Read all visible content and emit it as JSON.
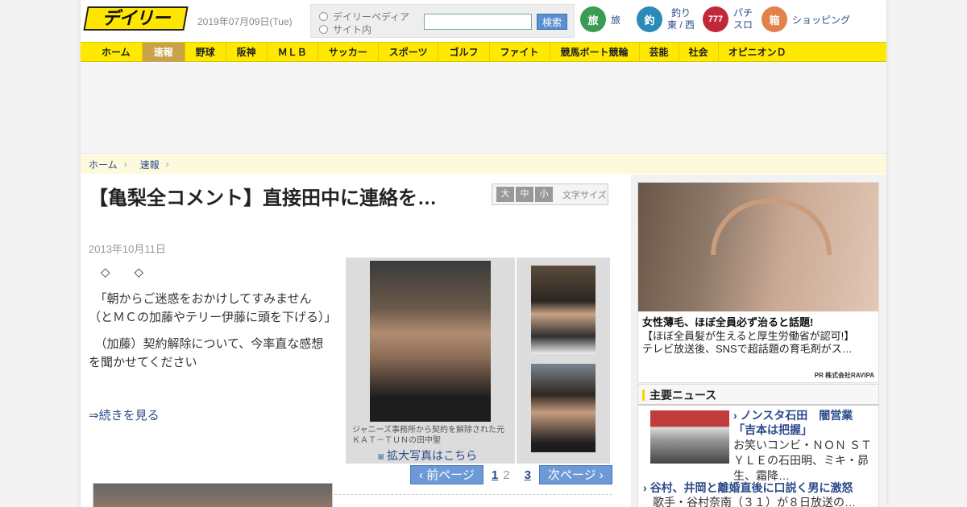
{
  "header": {
    "logo": "デイリー",
    "date": "2019年07月09日(Tue)",
    "search": {
      "option1": "デイリーペディア",
      "option2": "サイト内",
      "input_value": "",
      "button": "検索"
    },
    "links": [
      {
        "icon": "bus-icon",
        "icon_text": "旅",
        "label": "旅",
        "color": "#3a9b52"
      },
      {
        "icon": "fish-icon",
        "icon_text": "釣",
        "label1": "釣り",
        "label2": "東 / 西",
        "color": "#2b8ab8"
      },
      {
        "icon": "slot-777-icon",
        "icon_text": "777",
        "label1": "パチ",
        "label2": "スロ",
        "color": "#c0283a"
      },
      {
        "icon": "shopping-box-icon",
        "icon_text": "箱",
        "label": "ショッピング",
        "color": "#e2824a"
      }
    ]
  },
  "nav": [
    "ホーム",
    "速報",
    "野球",
    "阪神",
    "ＭＬＢ",
    "サッカー",
    "スポーツ",
    "ゴルフ",
    "ファイト",
    "競馬ボート競輪",
    "芸能",
    "社会",
    "オピニオンＤ"
  ],
  "nav_active": "速報",
  "breadcrumb": [
    "ホーム",
    "速報"
  ],
  "article": {
    "title": "【亀梨全コメント】直接田中に連絡を…",
    "date": "2013年10月11日",
    "font_size": {
      "large": "大",
      "medium": "中",
      "small": "小",
      "label": "文字サイズ"
    },
    "paragraphs": [
      "　◇　　◇",
      "　「朝からご迷惑をおかけしてすみません（とＭＣの加藤やテリー伊藤に頭を下げる）」",
      "　（加藤）契約解除について、今率直な感想を聞かせてください"
    ],
    "more": "⇒続きを見る",
    "photo_caption": "ジャニーズ事務所から契約を解除された元ＫＡＴ－ＴＵＮの田中聖",
    "photo_enlarge": "拡大写真はこちら"
  },
  "pager": {
    "prev": "前ページ",
    "pages": [
      "1",
      "2",
      "3"
    ],
    "current": "2",
    "next": "次ページ"
  },
  "sidebar": {
    "ad": {
      "title": "女性薄毛、ほぼ全員必ず治ると話題!",
      "line2": "【ほぼ全員髪が生えると厚生労働省が認可!】",
      "line3": "テレビ放送後、SNSで超話題の育毛剤がス…",
      "pr": "PR 株式会社RAVIPA"
    },
    "news_heading": "主要ニュース",
    "news": [
      {
        "title": "ノンスタ石田　闇営業「吉本は把握」",
        "desc": "お笑いコンビ・ＮＯＮ ＳＴＹＬＥの石田明、ミキ・昴生、霜降…"
      },
      {
        "title": "谷村、井岡と離婚直後に口説く男に激怒",
        "desc": "歌手・谷村奈南（３１）が８日放送の…"
      }
    ]
  }
}
